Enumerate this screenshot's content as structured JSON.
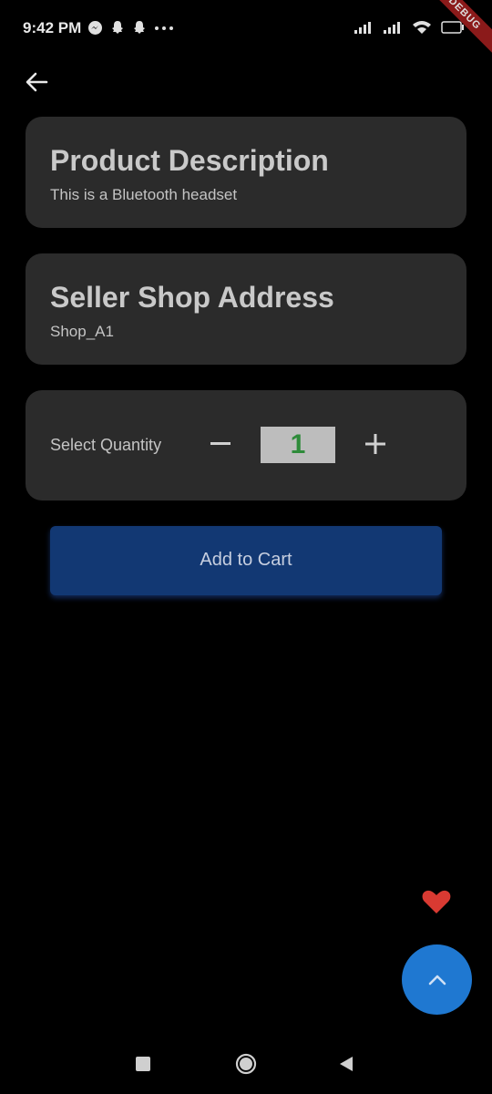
{
  "status_bar": {
    "time": "9:42 PM",
    "debug_label": "DEBUG"
  },
  "description_card": {
    "title": "Product Description",
    "text": "This is a Bluetooth headset"
  },
  "address_card": {
    "title": "Seller Shop Address",
    "text": "Shop_A1"
  },
  "quantity_card": {
    "label": "Select Quantity",
    "value": "1"
  },
  "cart_button": {
    "label": "Add to Cart"
  },
  "colors": {
    "background": "#000000",
    "card": "#2b2b2b",
    "cart_button": "#123873",
    "fab": "#1f78d1",
    "heart": "#d93a32",
    "quantity_value": "#2e8b3a"
  },
  "icons": {
    "back": "arrow-left-icon",
    "minus": "minus-icon",
    "plus": "plus-icon",
    "favorite": "heart-icon",
    "fab": "chevron-up-icon"
  }
}
